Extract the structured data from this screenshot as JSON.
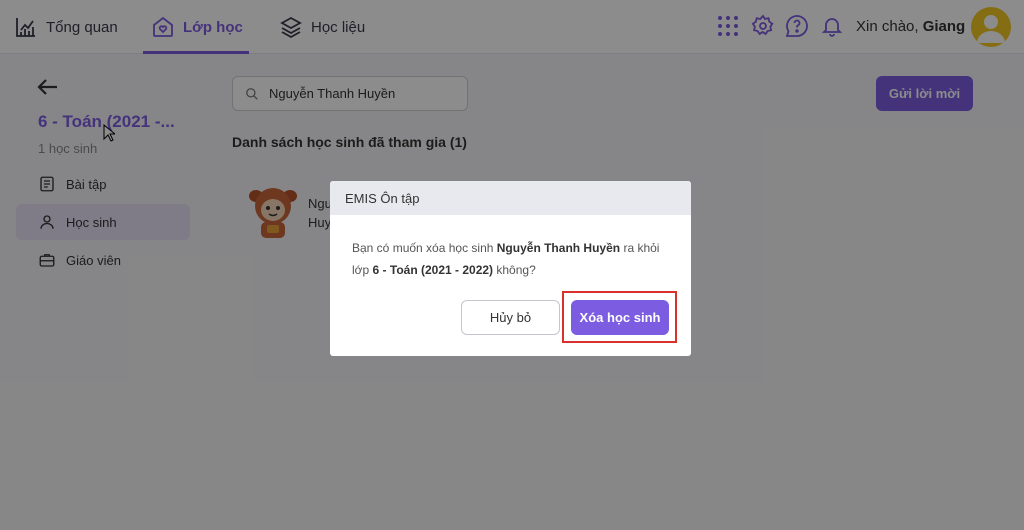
{
  "nav": {
    "items": [
      {
        "label": "Tổng quan",
        "icon": "chart-icon"
      },
      {
        "label": "Lớp học",
        "icon": "home-heart-icon",
        "active": true
      },
      {
        "label": "Học liệu",
        "icon": "layers-icon"
      }
    ],
    "greeting_prefix": "Xin chào, ",
    "user_name": "Giang",
    "icons": [
      "grid-apps-icon",
      "gear-icon",
      "help-icon",
      "bell-icon"
    ]
  },
  "sidebar": {
    "class_title": "6 - Toán (2021 -...",
    "student_count": "1 học sinh",
    "items": [
      {
        "label": "Bài tập",
        "icon": "assignment-icon"
      },
      {
        "label": "Học sinh",
        "icon": "person-icon",
        "active": true
      },
      {
        "label": "Giáo viên",
        "icon": "briefcase-icon"
      }
    ]
  },
  "main": {
    "search_value": "Nguyễn Thanh Huyền",
    "invite_button": "Gửi lời mời",
    "list_title": "Danh sách học sinh đã tham gia (1)",
    "student_name_partial_line1": "Ngu",
    "student_name_partial_line2": "Huy"
  },
  "dialog": {
    "title": "EMIS Ôn tập",
    "message_part1": "Bạn có muốn xóa học sinh ",
    "student_name": "Nguyễn Thanh Huyền",
    "message_part2": " ra khỏi lớp ",
    "class_name": "6 - Toán (2021 - 2022)",
    "message_part3": " không?",
    "cancel_label": "Hủy bỏ",
    "delete_label": "Xóa học sinh"
  },
  "colors": {
    "accent": "#7c5ce0",
    "highlight": "#d9302e",
    "avatar_bg": "#f3c623"
  }
}
